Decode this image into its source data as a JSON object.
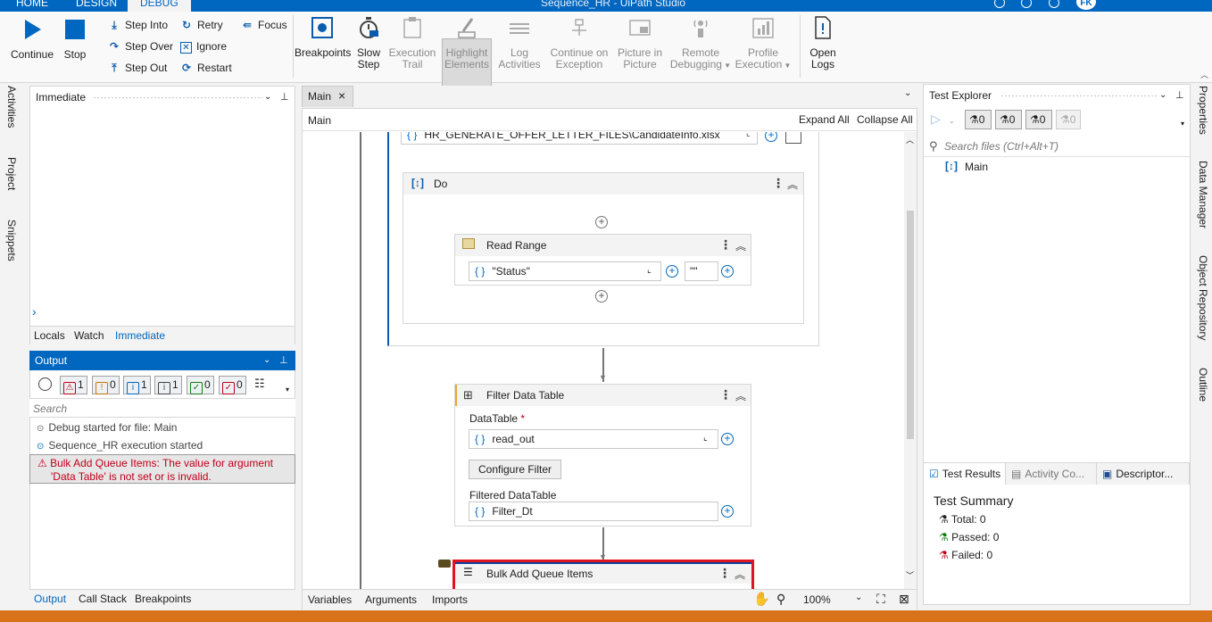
{
  "titlebar": {
    "tabs": [
      "HOME",
      "DESIGN",
      "DEBUG"
    ],
    "title": "Sequence_HR - UiPath Studio",
    "avatar": "FK"
  },
  "ribbon": {
    "continue": "Continue",
    "stop": "Stop",
    "step_into": "Step Into",
    "step_over": "Step Over",
    "step_out": "Step Out",
    "retry": "Retry",
    "ignore": "Ignore",
    "restart": "Restart",
    "focus": "Focus",
    "breakpoints": "Breakpoints",
    "slow_step_1": "Slow",
    "slow_step_2": "Step",
    "execution_trail_1": "Execution",
    "execution_trail_2": "Trail",
    "highlight_1": "Highlight",
    "highlight_2": "Elements",
    "log_1": "Log",
    "log_2": "Activities",
    "continue_exc_1": "Continue on",
    "continue_exc_2": "Exception",
    "pip_1": "Picture in",
    "pip_2": "Picture",
    "remote_1": "Remote",
    "remote_2": "Debugging",
    "profile_1": "Profile",
    "profile_2": "Execution",
    "open_logs_1": "Open",
    "open_logs_2": "Logs"
  },
  "left_strip": [
    "Activities",
    "Project",
    "Snippets"
  ],
  "right_strip": [
    "Properties",
    "Data Manager",
    "Object Repository",
    "Outline"
  ],
  "immediate": {
    "title": "Immediate",
    "prompt": "›",
    "tabs": [
      "Locals",
      "Watch",
      "Immediate"
    ]
  },
  "output": {
    "title": "Output",
    "filters": [
      {
        "icon": "⚠",
        "count": "1",
        "color": "#c0001a"
      },
      {
        "icon": "!",
        "count": "0",
        "color": "#c77700"
      },
      {
        "icon": "i",
        "count": "1",
        "color": "#0067c0"
      },
      {
        "icon": "i",
        "count": "1",
        "color": "#444444"
      },
      {
        "icon": "✓",
        "count": "0",
        "color": "#107c10"
      },
      {
        "icon": "✓",
        "count": "0",
        "color": "#c0001a"
      }
    ],
    "search_placeholder": "Search",
    "lines": [
      {
        "icon": "⊙",
        "text": "Debug started for file: Main"
      },
      {
        "icon": "⊙",
        "text": "Sequence_HR execution started"
      }
    ],
    "error_line1": "⚠  Bulk Add Queue Items: The value for argument",
    "error_line2": "'Data Table' is not set or is invalid.",
    "tabs": [
      "Output",
      "Call Stack",
      "Breakpoints"
    ]
  },
  "designer": {
    "tab": "Main",
    "breadcrumb": "Main",
    "expand_all": "Expand All",
    "collapse_all": "Collapse All",
    "file_path": "HR_GENERATE_OFFER_LETTER_FILES\\CandidateInfo.xlsx",
    "do_title": "Do",
    "read_range": {
      "title": "Read Range",
      "sheet": "\"Status\"",
      "range": "\"\""
    },
    "filter": {
      "title": "Filter Data Table",
      "datatable_label": "DataTable",
      "required": "*",
      "datatable_value": "read_out",
      "configure": "Configure Filter",
      "filtered_label": "Filtered DataTable",
      "filtered_value": "Filter_Dt"
    },
    "bulk_add": {
      "title": "Bulk Add Queue Items"
    },
    "bottom_tabs": [
      "Variables",
      "Arguments",
      "Imports"
    ],
    "zoom": "100%"
  },
  "test_explorer": {
    "title": "Test Explorer",
    "counts": [
      "0",
      "0",
      "0",
      "0"
    ],
    "search_placeholder": "Search files (Ctrl+Alt+T)",
    "tree_item": "Main"
  },
  "test_results": {
    "tabs": [
      "Test Results",
      "Activity Co...",
      "Descriptor..."
    ],
    "summary_title": "Test Summary",
    "total": "Total: 0",
    "passed": "Passed: 0",
    "failed": "Failed: 0"
  },
  "colors": {
    "accent": "#0067c0",
    "error": "#c0001a",
    "status": "#d9731a"
  }
}
